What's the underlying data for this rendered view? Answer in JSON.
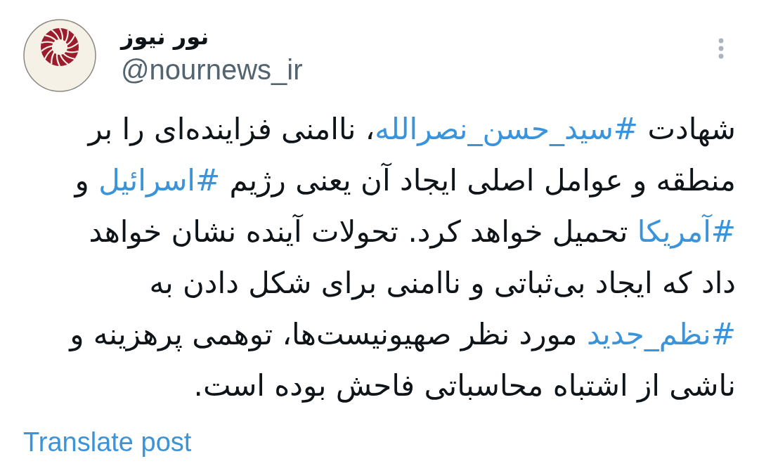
{
  "post": {
    "author": {
      "display_name": "نور نیوز",
      "handle": "@nournews_ir"
    },
    "body": [
      {
        "kind": "text",
        "text": "شهادت "
      },
      {
        "kind": "hashtag",
        "text": "#سید_حسن_نصرالله"
      },
      {
        "kind": "text",
        "text": "، ناامنی فزاینده‌ای را بر منطقه و عوامل اصلی ایجاد آن یعنی رژیم "
      },
      {
        "kind": "hashtag",
        "text": "#اسرائیل"
      },
      {
        "kind": "text",
        "text": " و "
      },
      {
        "kind": "hashtag",
        "text": "#آمریکا"
      },
      {
        "kind": "text",
        "text": " تحمیل خواهد کرد. تحولات آینده نشان خواهد داد که ایجاد بی‌ثباتی و ناامنی برای شکل دادن به "
      },
      {
        "kind": "hashtag",
        "text": "#نظم_جدید"
      },
      {
        "kind": "text",
        "text": " مورد نظر صهیونیست‌ها، توهمی پرهزینه و ناشی از اشتباه محاسباتی فاحش بوده است."
      }
    ],
    "translate_link": "Translate post"
  }
}
